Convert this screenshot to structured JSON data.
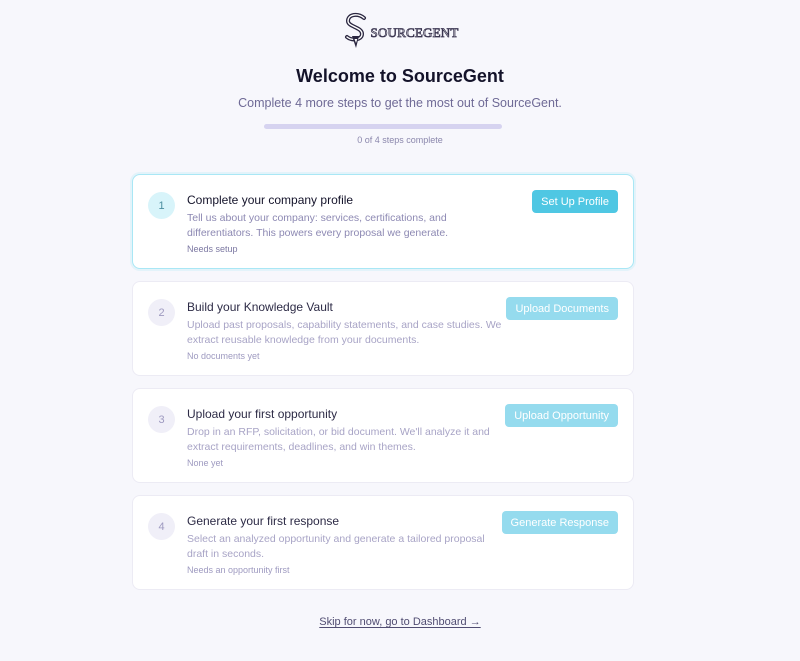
{
  "logo": {
    "icon": "sourcegent-logo-icon",
    "text": "SOURCEGENT"
  },
  "header": {
    "title": "Welcome to SourceGent",
    "subtitle": "Complete 4 more steps to get the most out of SourceGent."
  },
  "progress": {
    "completed": 0,
    "total": 4,
    "percent": 0,
    "label": "0 of 4 steps complete"
  },
  "colors": {
    "accent": "#4fc7e3",
    "accent_muted": "#95dbee",
    "active_border": "#a9e7f5",
    "progress_track": "#d6d3f0"
  },
  "steps": [
    {
      "number": "1",
      "title": "Complete your company profile",
      "description": "Tell us about your company: services, certifications, and differentiators. This powers every proposal we generate.",
      "status": "Needs setup",
      "button": "Set Up Profile",
      "active": true
    },
    {
      "number": "2",
      "title": "Build your Knowledge Vault",
      "description": "Upload past proposals, capability statements, and case studies. We extract reusable knowledge from your documents.",
      "status": "No documents yet",
      "button": "Upload Documents",
      "active": false
    },
    {
      "number": "3",
      "title": "Upload your first opportunity",
      "description": "Drop in an RFP, solicitation, or bid document. We'll analyze it and extract requirements, deadlines, and win themes.",
      "status": "None yet",
      "button": "Upload Opportunity",
      "active": false
    },
    {
      "number": "4",
      "title": "Generate your first response",
      "description": "Select an analyzed opportunity and generate a tailored proposal draft in seconds.",
      "status": "Needs an opportunity first",
      "button": "Generate Response",
      "active": false
    }
  ],
  "skip_link": "Skip for now, go to Dashboard →"
}
